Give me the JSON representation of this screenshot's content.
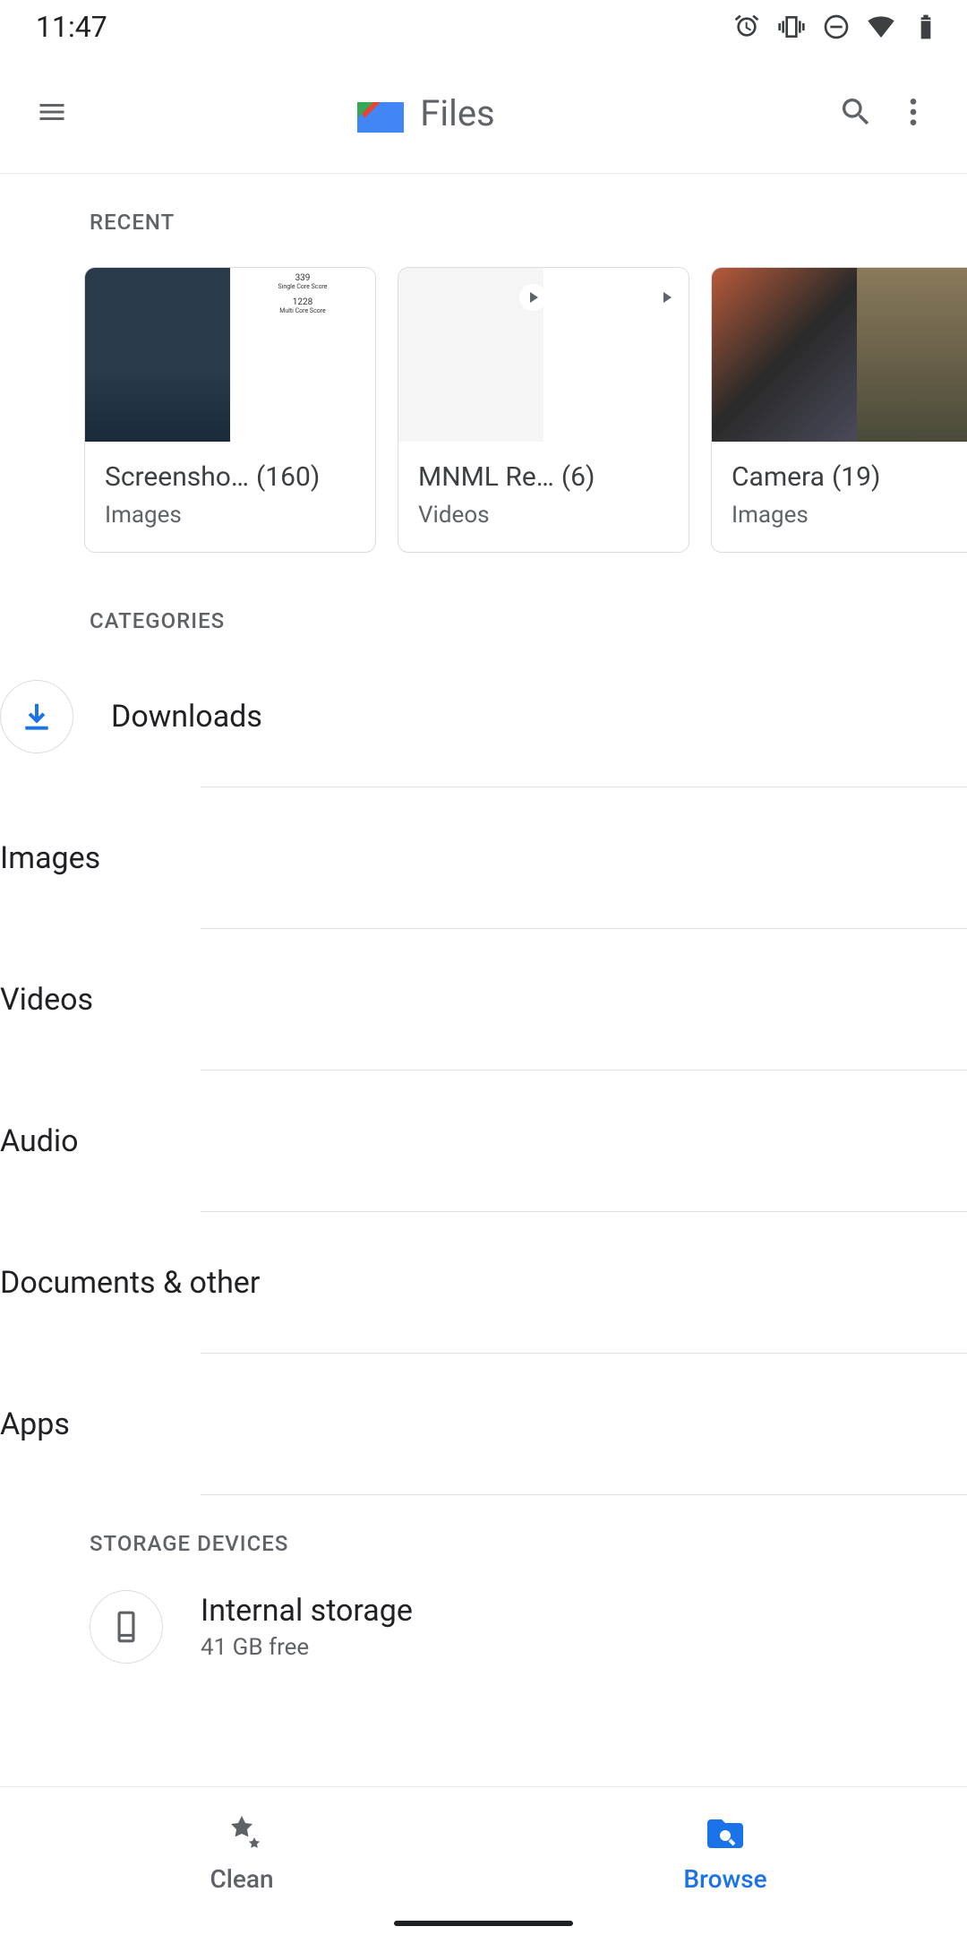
{
  "status": {
    "time": "11:47"
  },
  "header": {
    "title": "Files"
  },
  "sections": {
    "recent": "RECENT",
    "categories": "CATEGORIES",
    "storage": "STORAGE DEVICES"
  },
  "recent": [
    {
      "name": "Screensho…",
      "count": "(160)",
      "sub": "Images"
    },
    {
      "name": "MNML Re…",
      "count": "(6)",
      "sub": "Videos"
    },
    {
      "name": "Camera",
      "count": "(19)",
      "sub": "Images"
    }
  ],
  "categories": [
    {
      "label": "Downloads",
      "icon": "download",
      "color": "#1a73e8"
    },
    {
      "label": "Images",
      "icon": "image",
      "color": "#ea4335"
    },
    {
      "label": "Videos",
      "icon": "video",
      "color": "#34a853"
    },
    {
      "label": "Audio",
      "icon": "audio",
      "color": "#a142f4"
    },
    {
      "label": "Documents & other",
      "icon": "document",
      "color": "#24c1e0"
    },
    {
      "label": "Apps",
      "icon": "apps",
      "color": "#5f6368"
    }
  ],
  "storage": [
    {
      "name": "Internal storage",
      "sub": "41 GB free"
    }
  ],
  "nav": {
    "clean": "Clean",
    "browse": "Browse"
  }
}
